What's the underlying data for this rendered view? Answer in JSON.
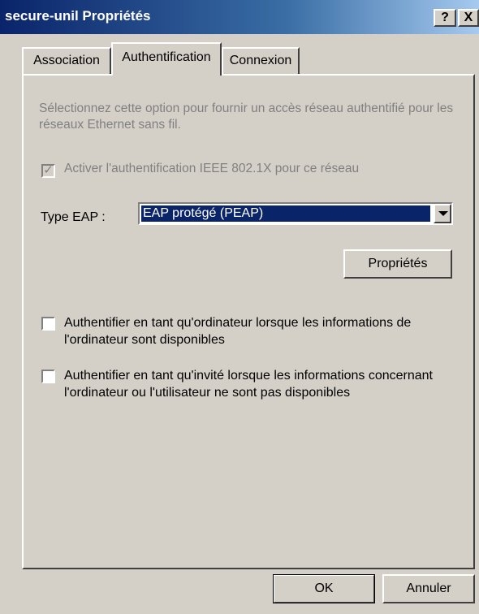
{
  "window": {
    "title": "secure-unil Propriétés",
    "help_label": "?",
    "close_label": "X"
  },
  "tabs": [
    {
      "label": "Association",
      "selected": false
    },
    {
      "label": "Authentification",
      "selected": true
    },
    {
      "label": "Connexion",
      "selected": false
    }
  ],
  "auth": {
    "description": "Sélectionnez cette option pour fournir un accès réseau authentifié pour les réseaux Ethernet sans fil.",
    "enable_8021x": {
      "label": "Activer l'authentification IEEE 802.1X pour ce réseau",
      "checked": true,
      "enabled": false
    },
    "eap_type_label": "Type EAP :",
    "eap_type_value": "EAP protégé (PEAP)",
    "properties_label": "Propriétés",
    "auth_as_computer": {
      "label": "Authentifier en tant qu'ordinateur lorsque les informations de l'ordinateur sont disponibles",
      "checked": false
    },
    "auth_as_guest": {
      "label": "Authentifier en tant qu'invité lorsque les informations concernant l'ordinateur ou l'utilisateur ne sont pas disponibles",
      "checked": false
    }
  },
  "footer": {
    "ok_label": "OK",
    "cancel_label": "Annuler"
  },
  "colors": {
    "titlebar_start": "#0a246a",
    "dialog_face": "#d4d0c8",
    "selection": "#0a246a",
    "disabled_text": "#808080"
  }
}
